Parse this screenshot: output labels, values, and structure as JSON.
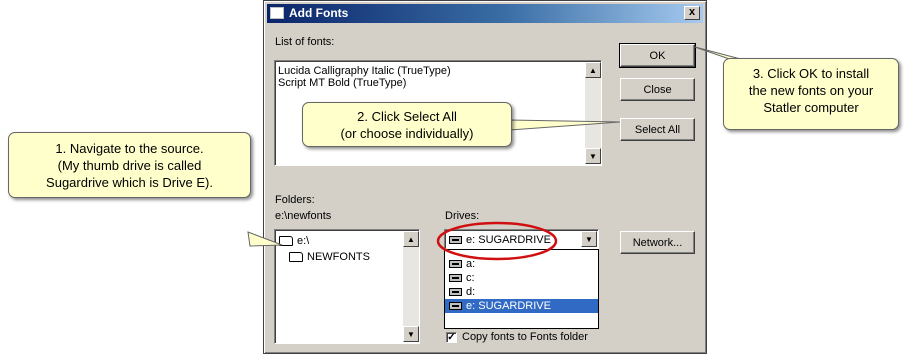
{
  "dialog": {
    "title": "Add Fonts",
    "close_glyph": "x",
    "list_label": "List of fonts:",
    "fonts": [
      "Lucida Calligraphy Italic (TrueType)",
      "Script MT Bold (TrueType)"
    ],
    "folders_label": "Folders:",
    "current_path": "e:\\newfonts",
    "folders": [
      {
        "name": "e:\\"
      },
      {
        "name": "NEWFONTS"
      }
    ],
    "drives_label": "Drives:",
    "selected_drive": "e: SUGARDRIVE",
    "drives": [
      "a:",
      "c:",
      "d:",
      "e: SUGARDRIVE"
    ],
    "copy_checkbox_label": "Copy fonts to Fonts folder",
    "copy_checked": true,
    "check_glyph": "✓",
    "buttons": {
      "ok": "OK",
      "close": "Close",
      "select_all": "Select All",
      "network": "Network..."
    }
  },
  "annotations": {
    "step1": [
      "1. Navigate to the source.",
      "(My thumb drive is called",
      "Sugardrive which is Drive E)."
    ],
    "step2": [
      "2. Click Select All",
      "(or choose individually)"
    ],
    "step3": [
      "3. Click OK to install",
      "the new fonts  on your",
      "Statler computer"
    ]
  },
  "colors": {
    "callout_bg": "#ffffcc",
    "highlight_ellipse": "#d01010",
    "selection": "#316ac5"
  }
}
